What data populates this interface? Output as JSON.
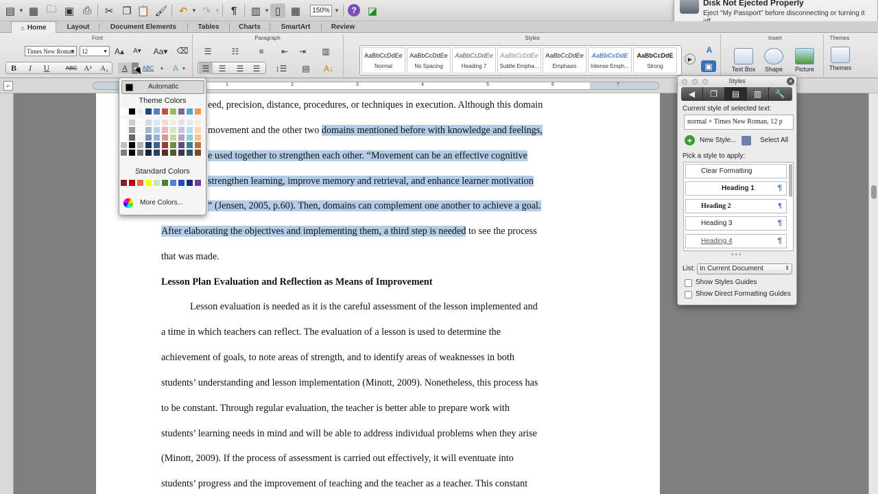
{
  "toolbar": {
    "zoom": "150%",
    "pilcrow_icon": "¶",
    "help_icon": "?"
  },
  "notification": {
    "title": "Disk Not Ejected Properly",
    "body": "Eject \"My Passport\" before disconnecting or turning it off."
  },
  "tabs": [
    "Home",
    "Layout",
    "Document Elements",
    "Tables",
    "Charts",
    "SmartArt",
    "Review"
  ],
  "ribbon": {
    "groups": {
      "font": "Font",
      "paragraph": "Paragraph",
      "styles": "Styles",
      "insert": "Insert",
      "themes": "Themes"
    },
    "font_name": "Times New Roman",
    "font_size": "12",
    "style_tiles": [
      {
        "sample": "AaBbCcDdEe",
        "name": "Normal"
      },
      {
        "sample": "AaBbCcDdEe",
        "name": "No Spacing"
      },
      {
        "sample": "AaBbCcDdEe",
        "name": "Heading 7"
      },
      {
        "sample": "AaBbCcDdEe",
        "name": "Subtle Empha..."
      },
      {
        "sample": "AaBbCcDdEe",
        "name": "Emphasis"
      },
      {
        "sample": "AaBbCcDdE",
        "name": "Intense Emph..."
      },
      {
        "sample": "AaBbCcDdE",
        "name": "Strong"
      }
    ],
    "insert_items": [
      "Text Box",
      "Shape",
      "Picture"
    ],
    "themes_label": "Themes"
  },
  "ruler": {
    "numbers": [
      "1",
      "2",
      "3",
      "4",
      "5",
      "6",
      "7"
    ]
  },
  "color_picker": {
    "automatic": "Automatic",
    "theme_colors": "Theme Colors",
    "standard_colors": "Standard Colors",
    "more_colors": "More Colors...",
    "theme_row": [
      "#ffffff",
      "#000000",
      "#eeece1",
      "#1f497d",
      "#4f81bd",
      "#c0504d",
      "#9bbb59",
      "#8064a2",
      "#4bacc6",
      "#f79646"
    ],
    "standard_row": [
      "#7f1f2c",
      "#c00000",
      "#e26b4a",
      "#ffff00",
      "#c6e7b0",
      "#4f7f34",
      "#4a86c8",
      "#1f4fbf",
      "#1f2f6f",
      "#6f3f9f"
    ],
    "accent": "#1f4fbf"
  },
  "document": {
    "lines": [
      {
        "pre": "eed, precision, distance, procedures, or techniques in execution. Although this domain",
        "hl": "",
        "post": ""
      },
      {
        "pre": "movement and the other two ",
        "hl": "domains mentioned before with knowledge and feelings,",
        "post": ""
      },
      {
        "pre": "",
        "hl": "e used together to strengthen each other. “Movement can be an effective cognitive",
        "post": ""
      },
      {
        "pre": "",
        "hl": "strengthen learning, improve memory and retrieval, and enhance learner motivation",
        "post": ""
      },
      {
        "pre": "",
        "hl": "” (Jensen, 2005, p.60). Then, domains can complement one another to achieve a goal.",
        "post": ""
      },
      {
        "pre": "",
        "hl": "After elaborating the objectives and implementing them, a third step is needed",
        "post": " to see the process"
      },
      {
        "pre": "that was made.",
        "hl": "",
        "post": ""
      }
    ],
    "heading": "Lesson Plan Evaluation and Reflection as Means of Improvement",
    "para_lines": [
      "Lesson evaluation is needed as it is the careful assessment of the lesson implemented and",
      "a time in which teachers can reflect. The evaluation of a lesson is used to determine the",
      "achievement of goals, to note areas of strength, and to identify areas of weaknesses in both",
      "students’ understanding and lesson implementation (Minott, 2009). Nonetheless, this process has",
      "to be constant. Through regular evaluation, the teacher is better able to prepare work with",
      "students’ learning needs in mind and will be able to address individual problems when they arise",
      "(Minott, 2009). If the process of assessment is carried out effectively, it will eventuate into",
      "students’ progress and the improvement of teaching and the teacher as a teacher. This constant"
    ]
  },
  "styles_palette": {
    "title": "Styles",
    "current_label": "Current style of selected text:",
    "current_value": "normal + Times New Roman, 12 p",
    "new_style": "New Style...",
    "select_all": "Select All",
    "pick_label": "Pick a style to apply:",
    "items": [
      "Clear Formatting",
      "Heading 1",
      "Heading 2",
      "Heading 3",
      "Heading 4"
    ],
    "list_label": "List:",
    "list_value": "In Current Document",
    "show_guides": "Show Styles Guides",
    "show_direct": "Show Direct Formatting Guides"
  }
}
